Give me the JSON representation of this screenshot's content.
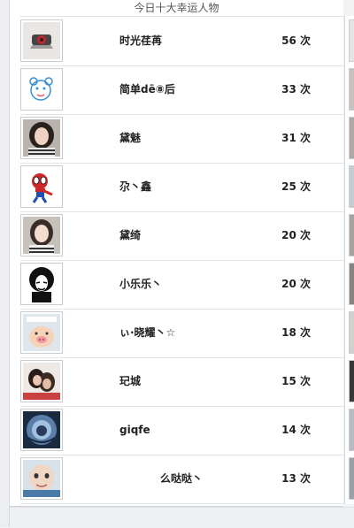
{
  "panel": {
    "title": "今日十大幸运人物",
    "rows": [
      {
        "name": "时光荏苒",
        "count": "56 次",
        "avatar": "ninja-headband-icon",
        "color": "#b22222"
      },
      {
        "name": "简单dē⑧后",
        "count": "33 次",
        "avatar": "sketch-bear-icon",
        "color": "#3a8fd0"
      },
      {
        "name": "黛魅",
        "count": "31 次",
        "avatar": "girl-photo-icon",
        "color": "#6b5a52"
      },
      {
        "name": "尕丶鑫",
        "count": "25 次",
        "avatar": "spiderman-icon",
        "color": "#d02828"
      },
      {
        "name": "黛绮",
        "count": "20 次",
        "avatar": "girl-photo-icon",
        "color": "#7a6c66"
      },
      {
        "name": "小乐乐丶",
        "count": "20 次",
        "avatar": "afro-silhouette-icon",
        "color": "#111111"
      },
      {
        "name": "ぃ·晓耀丶☆",
        "count": "18 次",
        "avatar": "pig-cartoon-icon",
        "color": "#f0c4a0"
      },
      {
        "name": "玘城",
        "count": "15 次",
        "avatar": "couple-photo-icon",
        "color": "#8a5a50"
      },
      {
        "name": "giqfe",
        "count": "14 次",
        "avatar": "fisheye-photo-icon",
        "color": "#3a5a8a"
      },
      {
        "name": "么哒哒丶",
        "count": "13 次",
        "avatar": "baby-photo-icon",
        "color": "#c8a890"
      }
    ]
  }
}
